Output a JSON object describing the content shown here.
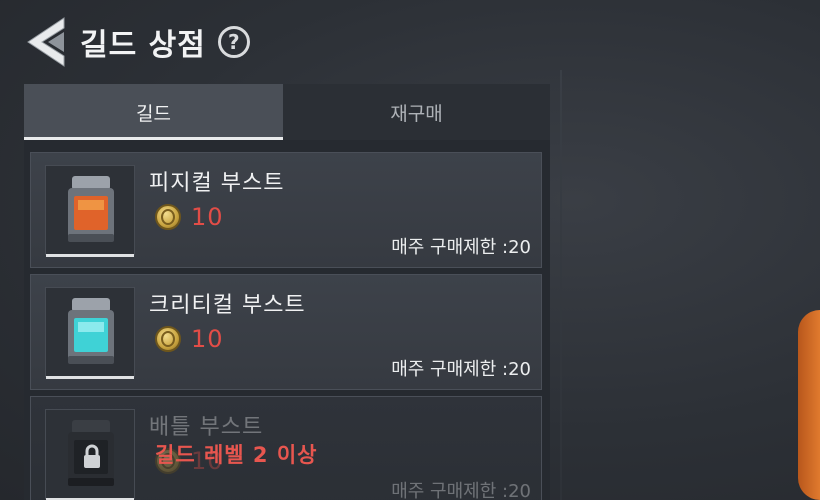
{
  "header": {
    "title": "길드 상점",
    "help_icon": "?"
  },
  "tabs": [
    {
      "label": "길드",
      "active": true
    },
    {
      "label": "재구매",
      "active": false
    }
  ],
  "items": [
    {
      "name": "피지컬 부스트",
      "price": "10",
      "limit": "매주 구매제한 :20",
      "color": "#e0632a",
      "locked": false
    },
    {
      "name": "크리티컬 부스트",
      "price": "10",
      "limit": "매주 구매제한 :20",
      "color": "#3fd2d6",
      "locked": false
    },
    {
      "name": "배틀 부스트",
      "price": "10",
      "limit": "매주 구매제한 :20",
      "color": "#555a62",
      "locked": true,
      "lock_message": "길드 레벨 2 이상"
    }
  ],
  "colors": {
    "price": "#e24d47",
    "lock_message": "#e8564f",
    "accent": "#e07a2e"
  }
}
